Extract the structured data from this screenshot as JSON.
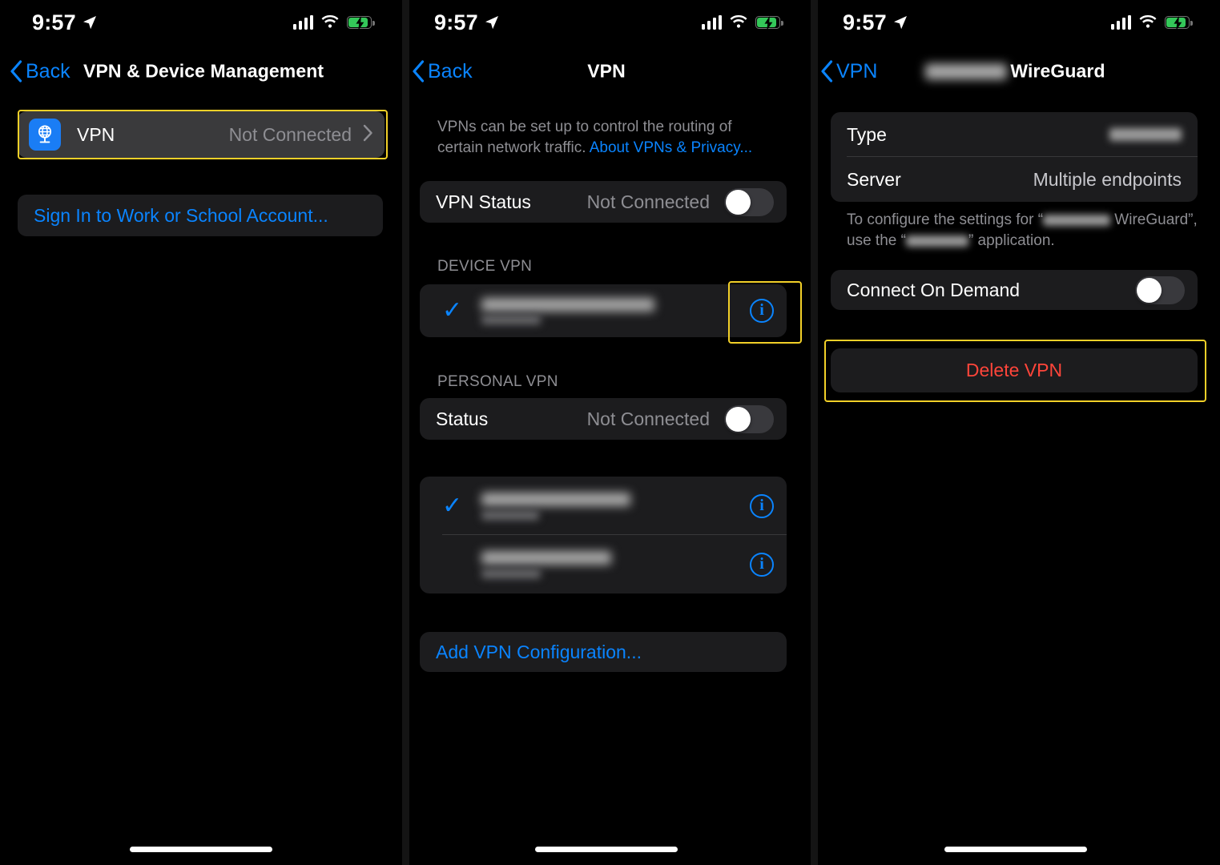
{
  "statusbar": {
    "time": "9:57",
    "location_icon": "location-arrow-icon",
    "signal_icon": "cellular-signal-icon",
    "wifi_icon": "wifi-icon",
    "battery_icon": "battery-charging-icon",
    "battery_charging": true
  },
  "panel1": {
    "back_label": "Back",
    "title": "VPN & Device Management",
    "vpn_row": {
      "icon": "vpn-globe-icon",
      "label": "VPN",
      "value": "Not Connected",
      "chevron": "chevron-right-icon",
      "highlighted": true
    },
    "sign_in_label": "Sign In to Work or School Account..."
  },
  "panel2": {
    "back_label": "Back",
    "title": "VPN",
    "intro_text": "VPNs can be set up to control the routing of certain network traffic. ",
    "intro_link": "About VPNs & Privacy...",
    "vpn_status": {
      "label": "VPN Status",
      "value": "Not Connected",
      "toggle_on": false
    },
    "device_vpn_header": "DEVICE VPN",
    "device_vpn_row": {
      "checked": true,
      "title_redacted": true,
      "subtitle_redacted": true,
      "info_button": "info-icon",
      "info_highlighted": true
    },
    "personal_vpn_header": "PERSONAL VPN",
    "personal_status": {
      "label": "Status",
      "value": "Not Connected",
      "toggle_on": false
    },
    "personal_list": [
      {
        "checked": true,
        "title_redacted": true,
        "subtitle_redacted": true,
        "info_button": "info-icon"
      },
      {
        "checked": false,
        "title_redacted": true,
        "subtitle_redacted": true,
        "info_button": "info-icon"
      }
    ],
    "add_config_label": "Add VPN Configuration..."
  },
  "panel3": {
    "back_label": "VPN",
    "title_redacted_prefix": true,
    "title_suffix": "WireGuard",
    "rows": [
      {
        "label": "Type",
        "value_redacted": true,
        "value": ""
      },
      {
        "label": "Server",
        "value_redacted": false,
        "value": "Multiple endpoints"
      }
    ],
    "footnote_part1": "To configure the settings for “",
    "footnote_part2": " WireGuard”, use the “",
    "footnote_part3": "” application.",
    "connect_on_demand": {
      "label": "Connect On Demand",
      "toggle_on": false
    },
    "delete_vpn_label": "Delete VPN",
    "delete_highlighted": true
  },
  "colors": {
    "accent_blue": "#0a84ff",
    "destructive_red": "#ff453a",
    "highlight_yellow": "#f2d028",
    "card_bg": "#1c1c1e",
    "selected_row_bg": "#3a3a3c",
    "secondary_text": "#8e8e93",
    "battery_green": "#34c759"
  }
}
